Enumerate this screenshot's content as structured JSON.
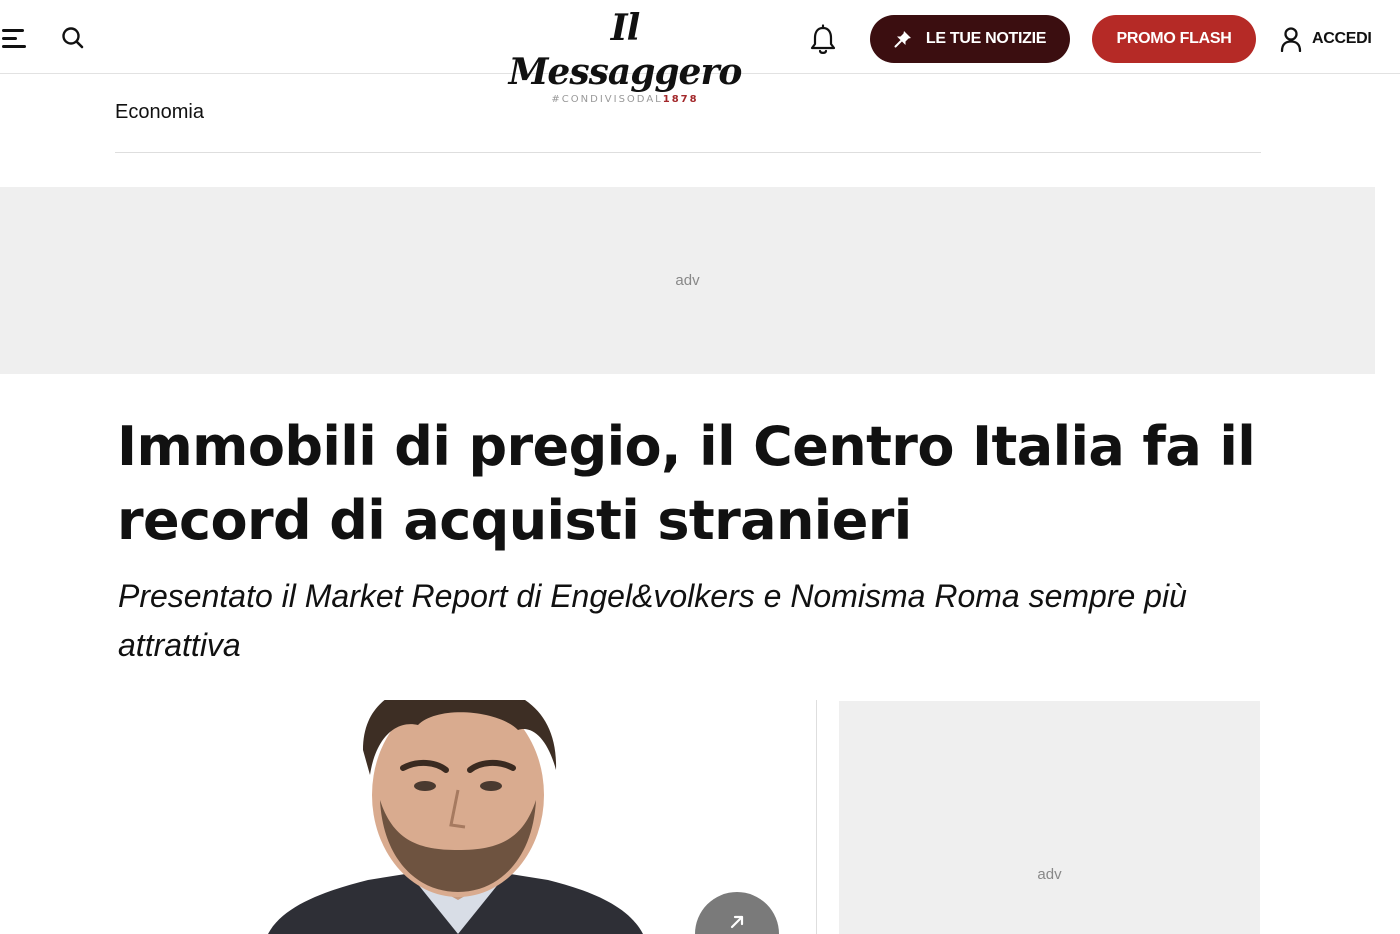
{
  "header": {
    "logo_name": "Il Messaggero",
    "logo_tag_prefix": "#CONDIVISODAL",
    "logo_tag_year": "1878",
    "notizie_label": "LE TUE NOTIZIE",
    "promo_label": "PROMO FLASH",
    "login_label": "ACCEDI",
    "icons": [
      "menu-icon",
      "search-icon",
      "bell-icon",
      "pin-icon",
      "user-icon"
    ],
    "colors": {
      "notizie_bg": "#3b0e10",
      "promo_bg": "#b52a26",
      "year": "#a3282b"
    }
  },
  "breadcrumb": {
    "section": "Economia"
  },
  "ads": {
    "banner_label": "adv",
    "side_label": "adv"
  },
  "article": {
    "title": "Immobili di pregio, il Centro Italia fa il record di acquisti stranieri",
    "subtitle": "Presentato il Market Report di Engel&volkers e Nomisma Roma sempre più attrattiva"
  },
  "media": {
    "expand_icon": "expand-arrow-icon"
  }
}
